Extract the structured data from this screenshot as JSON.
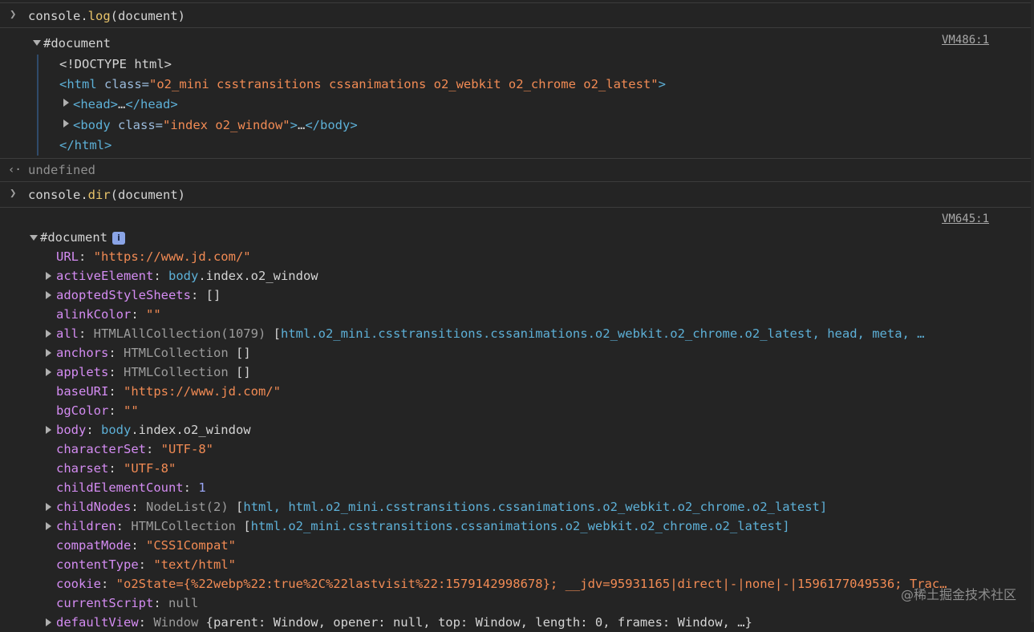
{
  "log_cmd": {
    "obj": "console",
    "dot": ".",
    "method": "log",
    "args": "(document)"
  },
  "log_output": {
    "vm": "VM486:1",
    "root": "#document",
    "doctype": "<!DOCTYPE html>",
    "html_open": {
      "tag_start": "<html",
      "attr": " class=",
      "value": "\"o2_mini csstransitions cssanimations o2_webkit o2_chrome o2_latest\"",
      "tag_end": ">"
    },
    "head": {
      "tag": "<head>",
      "ellipsis": "…",
      "close": "</head>"
    },
    "body": {
      "tag_start": "<body",
      "attr": " class=",
      "value": "\"index o2_window\"",
      "tag_end": ">",
      "ellipsis": "…",
      "close": "</body>"
    },
    "html_close": "</html>"
  },
  "undefined_result": "undefined",
  "dir_cmd": {
    "obj": "console",
    "dot": ".",
    "method": "dir",
    "args": "(document)"
  },
  "dir_output": {
    "vm": "VM645:1",
    "root": "#document",
    "info_icon": "i",
    "props": [
      {
        "key": "URL",
        "sep": ": ",
        "value": "\"https://www.jd.com/\""
      },
      {
        "key": "activeElement",
        "sep": ": ",
        "tag": "body",
        "rest": ".index.o2_window"
      },
      {
        "key": "adoptedStyleSheets",
        "sep": ": ",
        "value": "[]"
      },
      {
        "key": "alinkColor",
        "sep": ": ",
        "value": "\"\""
      },
      {
        "key": "all",
        "sep": ": ",
        "type": "HTMLAllCollection(1079) ",
        "bracket": "[",
        "items": "html.o2_mini.csstransitions.cssanimations.o2_webkit.o2_chrome.o2_latest, head, meta, …"
      },
      {
        "key": "anchors",
        "sep": ": ",
        "type": "HTMLCollection ",
        "value": "[]"
      },
      {
        "key": "applets",
        "sep": ": ",
        "type": "HTMLCollection ",
        "value": "[]"
      },
      {
        "key": "baseURI",
        "sep": ": ",
        "value": "\"https://www.jd.com/\""
      },
      {
        "key": "bgColor",
        "sep": ": ",
        "value": "\"\""
      },
      {
        "key": "body",
        "sep": ": ",
        "tag": "body",
        "rest": ".index.o2_window"
      },
      {
        "key": "characterSet",
        "sep": ": ",
        "value": "\"UTF-8\""
      },
      {
        "key": "charset",
        "sep": ": ",
        "value": "\"UTF-8\""
      },
      {
        "key": "childElementCount",
        "sep": ": ",
        "value": "1"
      },
      {
        "key": "childNodes",
        "sep": ": ",
        "type": "NodeList(2) ",
        "bracket": "[",
        "items": "html, html.o2_mini.csstransitions.cssanimations.o2_webkit.o2_chrome.o2_latest]"
      },
      {
        "key": "children",
        "sep": ": ",
        "type": "HTMLCollection ",
        "bracket": "[",
        "items": "html.o2_mini.csstransitions.cssanimations.o2_webkit.o2_chrome.o2_latest]"
      },
      {
        "key": "compatMode",
        "sep": ": ",
        "value": "\"CSS1Compat\""
      },
      {
        "key": "contentType",
        "sep": ": ",
        "value": "\"text/html\""
      },
      {
        "key": "cookie",
        "sep": ": ",
        "value": "\"o2State={%22webp%22:true%2C%22lastvisit%22:1579142998678}; __jdv=95931165|direct|-|none|-|1596177049536; Trac…"
      },
      {
        "key": "currentScript",
        "sep": ": ",
        "value": "null"
      },
      {
        "key": "defaultView",
        "sep": ": ",
        "type": "Window ",
        "value": "{parent: Window, opener: null, top: Window, length: 0, frames: Window, …}"
      }
    ]
  },
  "watermark": "@稀土掘金技术社区"
}
